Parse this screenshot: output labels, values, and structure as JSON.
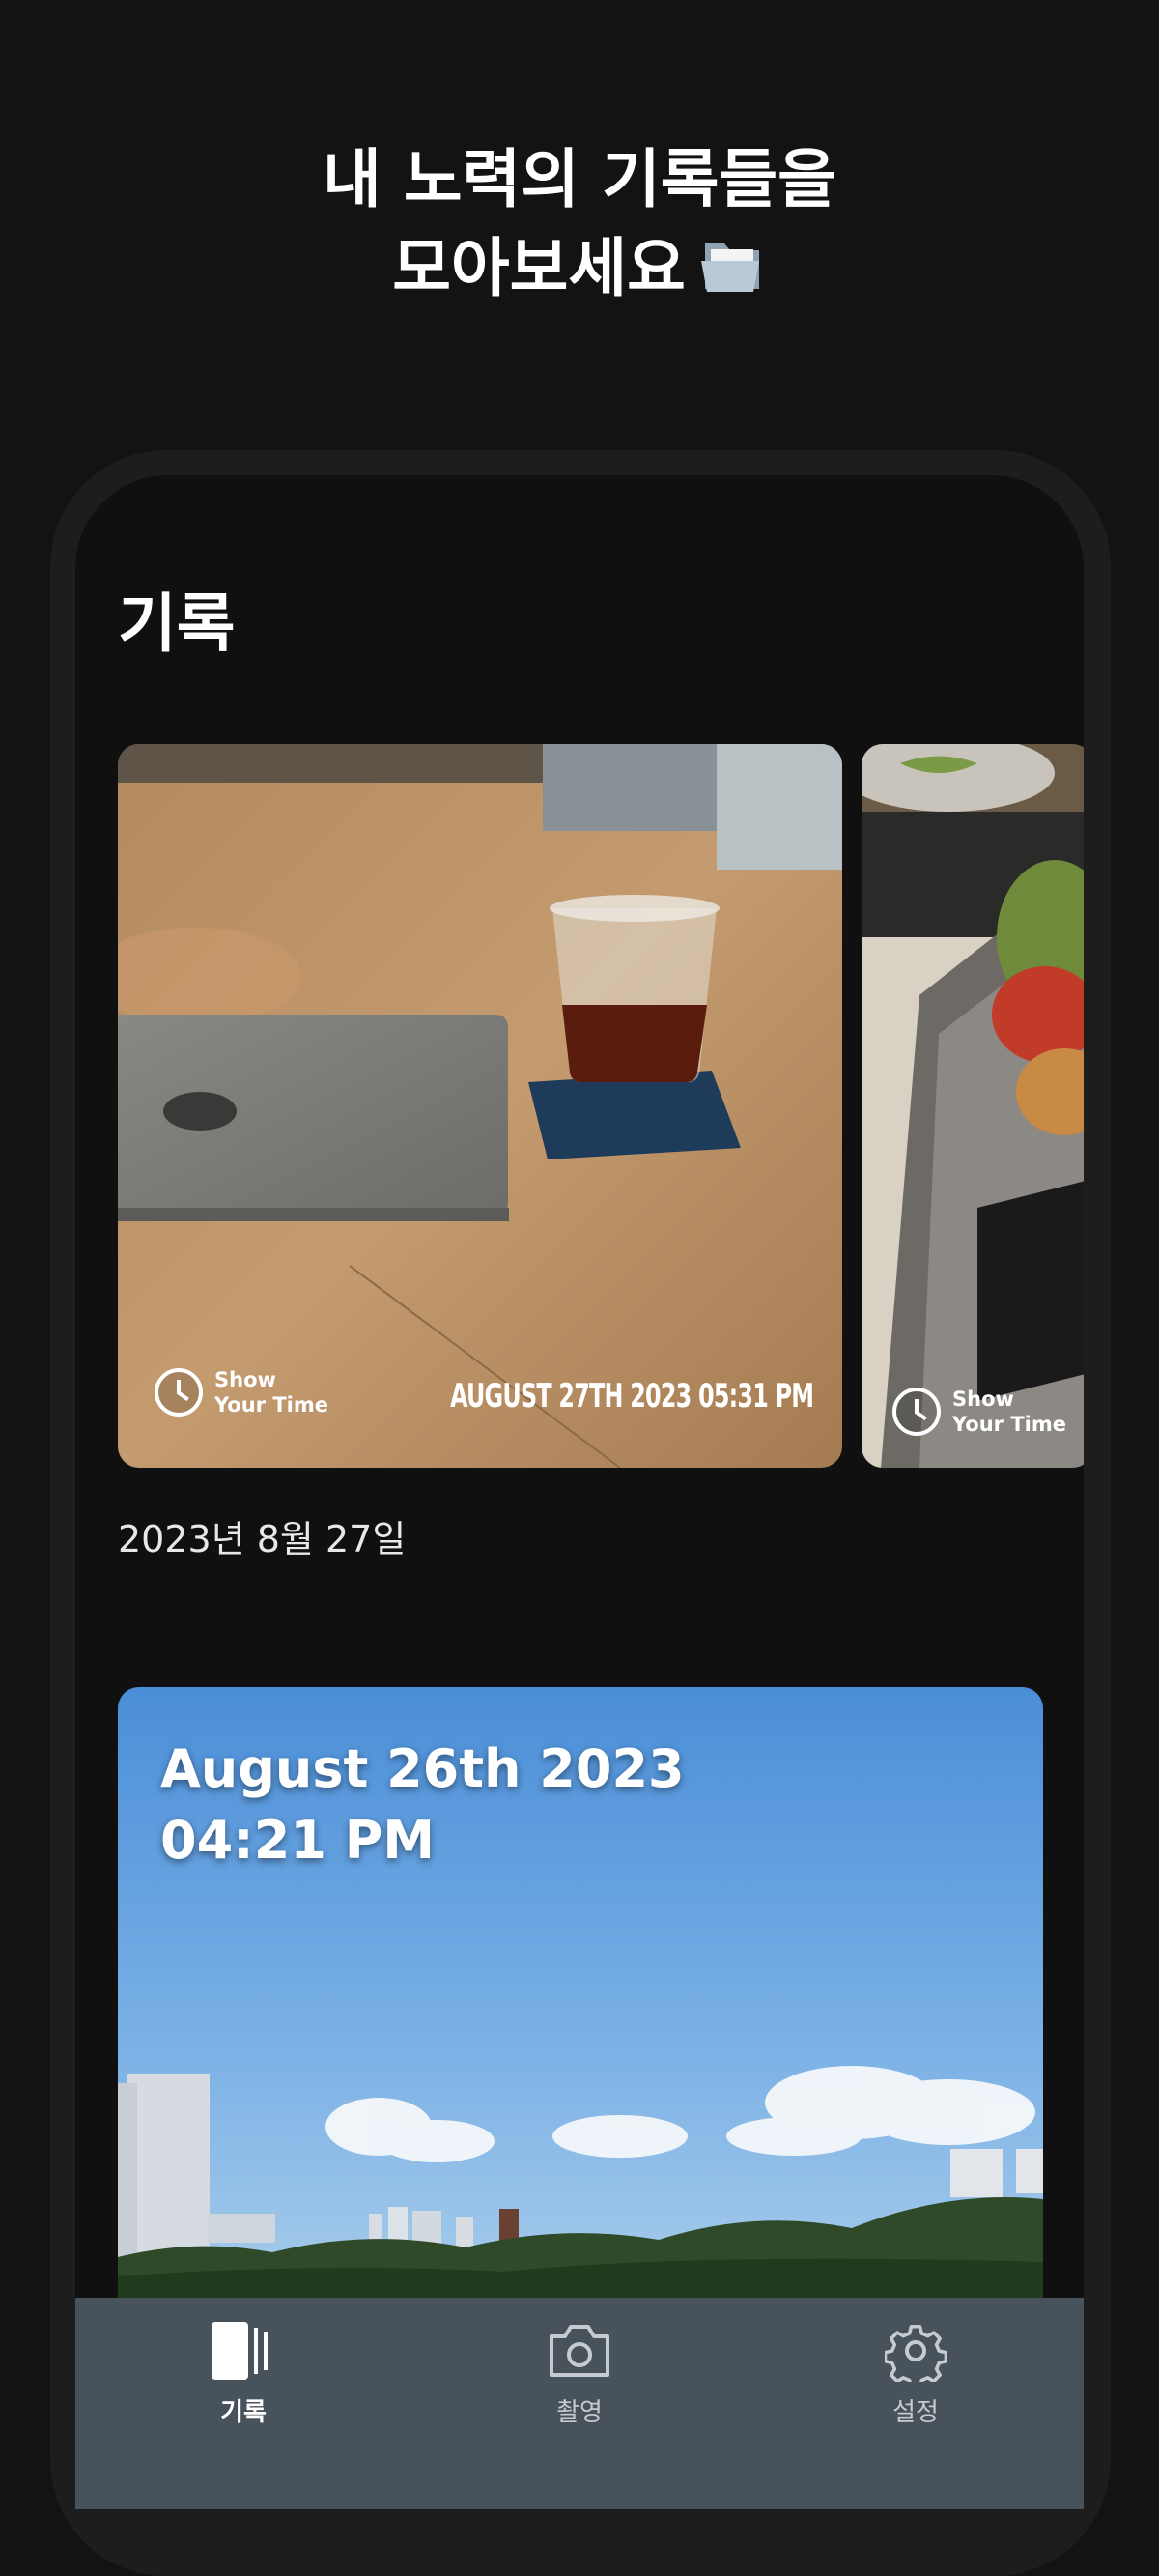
{
  "headline": {
    "line1": "내 노력의 기록들을",
    "line2": "모아보세요"
  },
  "screen": {
    "title": "기록",
    "cards": [
      {
        "watermark_brand_line1": "Show",
        "watermark_brand_line2": "Your Time",
        "stamp": "AUGUST 27TH 2023 05:31 PM"
      },
      {
        "watermark_brand_line1": "Show",
        "watermark_brand_line2": "Your Time"
      }
    ],
    "date_caption": "2023년 8월 27일",
    "second_card": {
      "stamp_line1": "August 26th 2023",
      "stamp_line2": "04:21 PM"
    }
  },
  "tabbar": {
    "tabs": [
      {
        "label": "기록",
        "icon": "records-icon",
        "active": true
      },
      {
        "label": "촬영",
        "icon": "camera-icon",
        "active": false
      },
      {
        "label": "설정",
        "icon": "gear-icon",
        "active": false
      }
    ]
  },
  "colors": {
    "background": "#131313",
    "tabbar": "#48525a"
  }
}
